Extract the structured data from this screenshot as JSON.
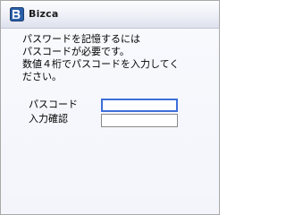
{
  "window": {
    "title": "Bizca",
    "app_icon": "bizca-logo-icon"
  },
  "instructions": {
    "lines": [
      "パスワードを記憶するには",
      "パスコードが必要です。",
      "数値４桁でパスコードを入力してく",
      "ださい。"
    ]
  },
  "form": {
    "passcode": {
      "label": "パスコード",
      "value": "",
      "focused": true
    },
    "confirm": {
      "label": "入力確認",
      "value": ""
    }
  },
  "colors": {
    "focus_border": "#3e6ed8",
    "icon_blue": "#2a5fa8",
    "background": "#f5f6fb"
  }
}
